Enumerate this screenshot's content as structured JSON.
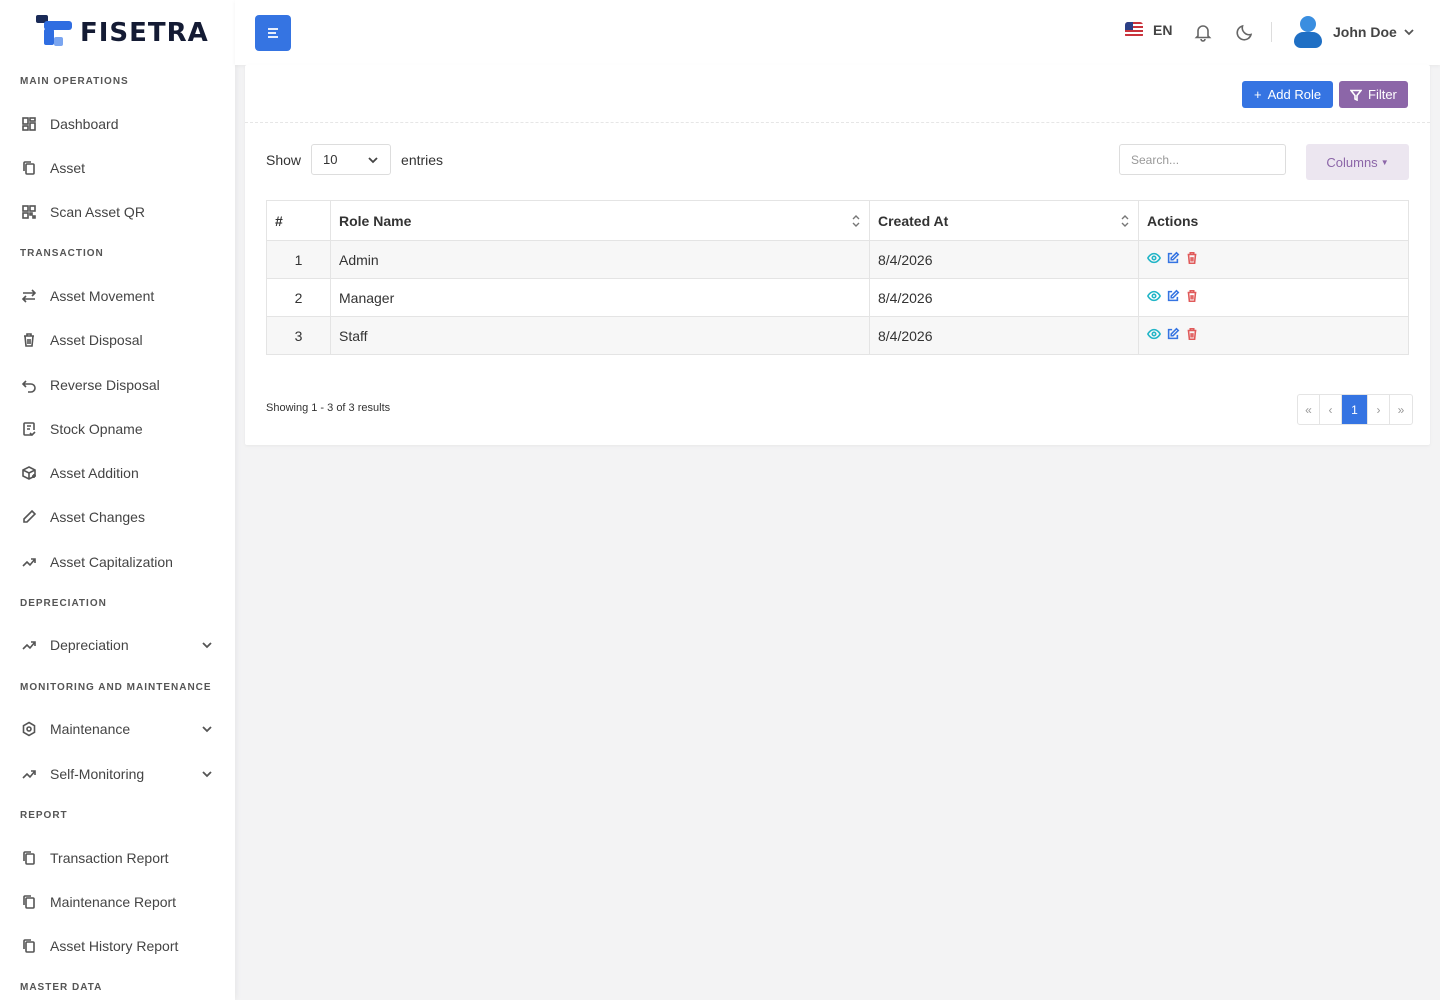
{
  "brand": {
    "name": "FISETRA"
  },
  "sidebar": {
    "sections": [
      {
        "title": "MAIN OPERATIONS"
      },
      {
        "title": "TRANSACTION"
      },
      {
        "title": "DEPRECIATION"
      },
      {
        "title": "MONITORING AND MAINTENANCE"
      },
      {
        "title": "REPORT"
      },
      {
        "title": "MASTER DATA"
      }
    ],
    "items": [
      {
        "label": "Dashboard",
        "icon": "dashboard-icon"
      },
      {
        "label": "Asset",
        "icon": "copy-icon"
      },
      {
        "label": "Scan Asset QR",
        "icon": "qr-icon"
      },
      {
        "label": "Asset Movement",
        "icon": "arrows-icon"
      },
      {
        "label": "Asset Disposal",
        "icon": "trash-icon"
      },
      {
        "label": "Reverse Disposal",
        "icon": "undo-icon"
      },
      {
        "label": "Stock Opname",
        "icon": "checklist-icon"
      },
      {
        "label": "Asset Addition",
        "icon": "box-plus-icon"
      },
      {
        "label": "Asset Changes",
        "icon": "pencil-icon"
      },
      {
        "label": "Asset Capitalization",
        "icon": "trend-icon"
      },
      {
        "label": "Depreciation",
        "icon": "trend-icon"
      },
      {
        "label": "Maintenance",
        "icon": "hexagon-icon"
      },
      {
        "label": "Self-Monitoring",
        "icon": "trend-icon"
      },
      {
        "label": "Transaction Report",
        "icon": "copy-icon"
      },
      {
        "label": "Maintenance Report",
        "icon": "copy-icon"
      },
      {
        "label": "Asset History Report",
        "icon": "copy-icon"
      }
    ]
  },
  "header": {
    "language": "EN",
    "user_name": "John Doe"
  },
  "toolbar": {
    "add_label": "Add Role",
    "filter_label": "Filter",
    "columns_label": "Columns"
  },
  "table_controls": {
    "show_label": "Show",
    "entries_value": "10",
    "entries_label": "entries",
    "search_placeholder": "Search..."
  },
  "table": {
    "headers": [
      "#",
      "Role Name",
      "Created At",
      "Actions"
    ],
    "rows": [
      {
        "num": "1",
        "role": "Admin",
        "created": "8/4/2026"
      },
      {
        "num": "2",
        "role": "Manager",
        "created": "8/4/2026"
      },
      {
        "num": "3",
        "role": "Staff",
        "created": "8/4/2026"
      }
    ]
  },
  "footer": {
    "showing": "Showing 1 - 3 of 3 results",
    "pages": [
      "«",
      "‹",
      "1",
      "›",
      "»"
    ]
  },
  "colors": {
    "primary": "#3574e2",
    "filter": "#8c66a8",
    "view": "#21b5c7",
    "delete": "#e05a5a"
  }
}
